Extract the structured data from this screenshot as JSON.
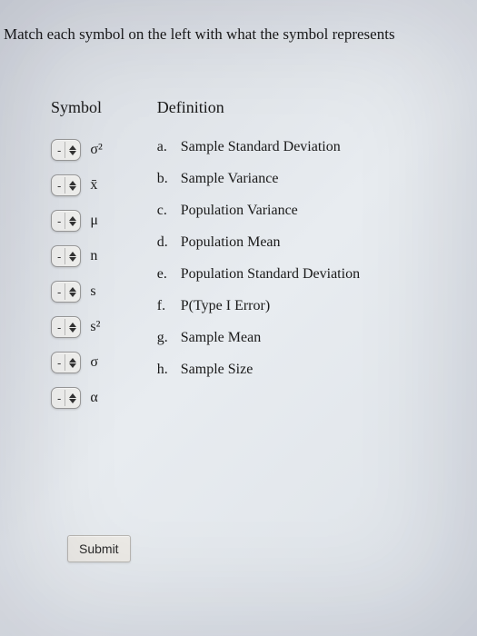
{
  "instruction": "Match each symbol on the left with what the symbol represents",
  "headers": {
    "symbol": "Symbol",
    "definition": "Definition"
  },
  "stepper": {
    "value": "-"
  },
  "symbols": [
    {
      "glyph": "σ²"
    },
    {
      "glyph": "x̄"
    },
    {
      "glyph": "μ"
    },
    {
      "glyph": "n"
    },
    {
      "glyph": "s"
    },
    {
      "glyph": "s²"
    },
    {
      "glyph": "σ"
    },
    {
      "glyph": "α"
    }
  ],
  "definitions": [
    {
      "letter": "a.",
      "text": "Sample Standard Deviation"
    },
    {
      "letter": "b.",
      "text": "Sample Variance"
    },
    {
      "letter": "c.",
      "text": "Population Variance"
    },
    {
      "letter": "d.",
      "text": "Population Mean"
    },
    {
      "letter": "e.",
      "text": "Population Standard Deviation"
    },
    {
      "letter": "f.",
      "text": "P(Type I Error)"
    },
    {
      "letter": "g.",
      "text": "Sample Mean"
    },
    {
      "letter": "h.",
      "text": "Sample Size"
    }
  ],
  "buttons": {
    "submit": "Submit"
  }
}
